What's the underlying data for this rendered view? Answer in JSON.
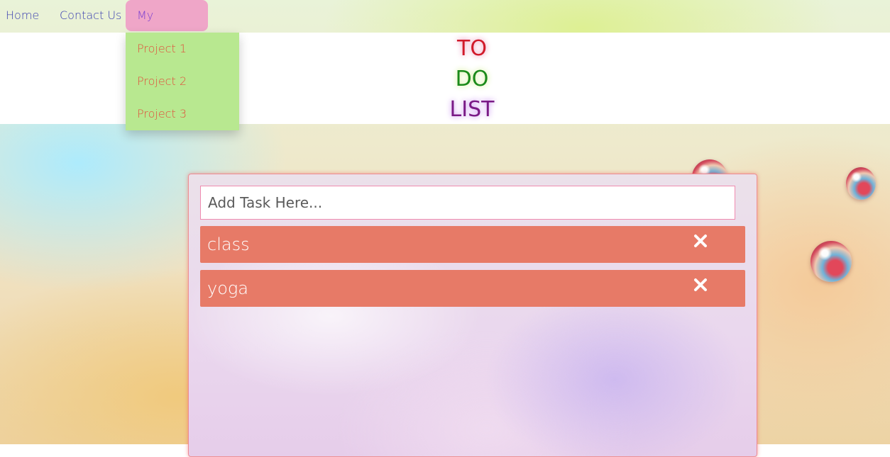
{
  "nav": {
    "home_label": "Home",
    "contact_label": "Contact Us",
    "projects_label": "My Projects"
  },
  "dropdown": {
    "items": [
      "Project 1",
      "Project 2",
      "Project 3"
    ]
  },
  "header": {
    "title_lines": [
      "TO",
      "DO",
      "LIST"
    ]
  },
  "todo": {
    "input_placeholder": "Add Task Here...",
    "input_value": "",
    "tasks": [
      {
        "label": "class",
        "delete_icon": "close-icon"
      },
      {
        "label": "yoga",
        "delete_icon": "close-icon"
      }
    ]
  },
  "colors": {
    "nav_text": "#3b3fb0",
    "nav_active_bg": "#efa6c8",
    "dropdown_bg": "#b8e890",
    "dropdown_text": "#e0513c",
    "task_bg": "#e77a67",
    "title_to": "#d11a2a",
    "title_do": "#1b8a1b",
    "title_list": "#7a1a86"
  }
}
